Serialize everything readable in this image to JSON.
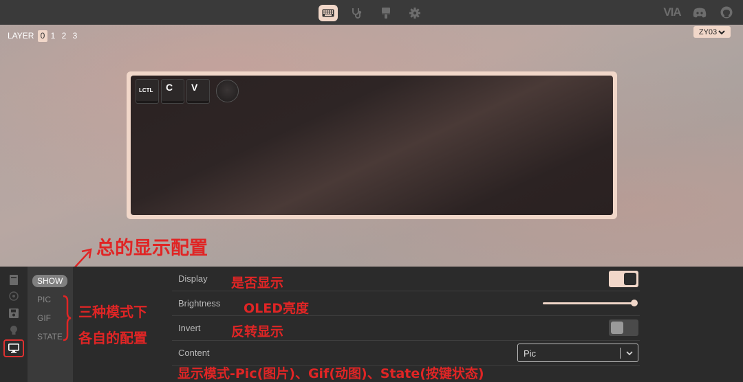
{
  "topbar": {
    "icons": [
      "keyboard-icon",
      "stethoscope-icon",
      "paintbrush-icon",
      "gear-icon"
    ],
    "right": {
      "brand": "VIA",
      "icons": [
        "discord-icon",
        "github-icon"
      ]
    }
  },
  "layer": {
    "label": "LAYER",
    "numbers": [
      "0",
      "1",
      "2",
      "3"
    ],
    "active": "0"
  },
  "device": {
    "name": "ZY03"
  },
  "keys": [
    "LCTL",
    "C",
    "V"
  ],
  "sidebar": {
    "icons": [
      "book-icon",
      "circle-dot-icon",
      "save-icon",
      "lightbulb-icon",
      "monitor-icon"
    ],
    "selected": "monitor-icon"
  },
  "submenu": {
    "items": [
      "SHOW",
      "PIC",
      "GIF",
      "STATE"
    ],
    "active": "SHOW"
  },
  "settings": {
    "display": {
      "label": "Display",
      "on": true
    },
    "brightness": {
      "label": "Brightness",
      "level": 1.0
    },
    "invert": {
      "label": "Invert",
      "on": false
    },
    "content": {
      "label": "Content",
      "value": "Pic"
    }
  },
  "annotations": {
    "overall": "总的显示配置",
    "display": "是否显示",
    "brightness": "OLED亮度",
    "invert": "反转显示",
    "modes_line1": "三种模式下",
    "modes_line2": "各自的配置",
    "content": "显示模式-Pic(图片)、Gif(动图)、State(按键状态)"
  },
  "colors": {
    "accent": "#f1d7c9",
    "annotation": "#e02525",
    "topbar": "#3a3a3a",
    "panel": "#2b2b2b"
  }
}
